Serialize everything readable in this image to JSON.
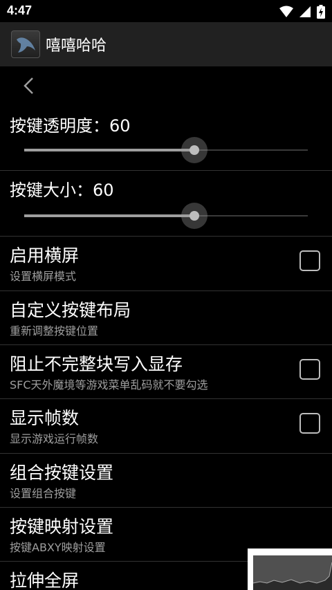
{
  "status_bar": {
    "time": "4:47"
  },
  "app_bar": {
    "title": "嘻嘻哈哈"
  },
  "sliders": [
    {
      "label": "按键透明度：60",
      "value": 60,
      "max": 100
    },
    {
      "label": "按键大小：60",
      "value": 60,
      "max": 100
    }
  ],
  "prefs": [
    {
      "title": "启用横屏",
      "summary": "设置横屏模式",
      "checkbox": true,
      "checked": false
    },
    {
      "title": "自定义按键布局",
      "summary": "重新调整按键位置",
      "checkbox": false
    },
    {
      "title": "阻止不完整块写入显存",
      "summary": "SFC天外魔境等游戏菜单乱码就不要勾选",
      "checkbox": true,
      "checked": false
    },
    {
      "title": "显示帧数",
      "summary": "显示游戏运行帧数",
      "checkbox": true,
      "checked": false
    },
    {
      "title": "组合按键设置",
      "summary": "设置组合按键",
      "checkbox": false
    },
    {
      "title": "按键映射设置",
      "summary": "按键ABXY映射设置",
      "checkbox": false
    },
    {
      "title": "拉伸全屏",
      "summary": "",
      "checkbox": false
    }
  ],
  "icons": {
    "wifi": "wifi-icon",
    "cellular": "cellular-signal-icon",
    "battery": "battery-icon",
    "back": "back-arrow-icon",
    "app": "app-icon"
  },
  "colors": {
    "background": "#000000",
    "app_bar": "#212121",
    "summary_text": "#9e9e9e",
    "divider": "#333333"
  }
}
